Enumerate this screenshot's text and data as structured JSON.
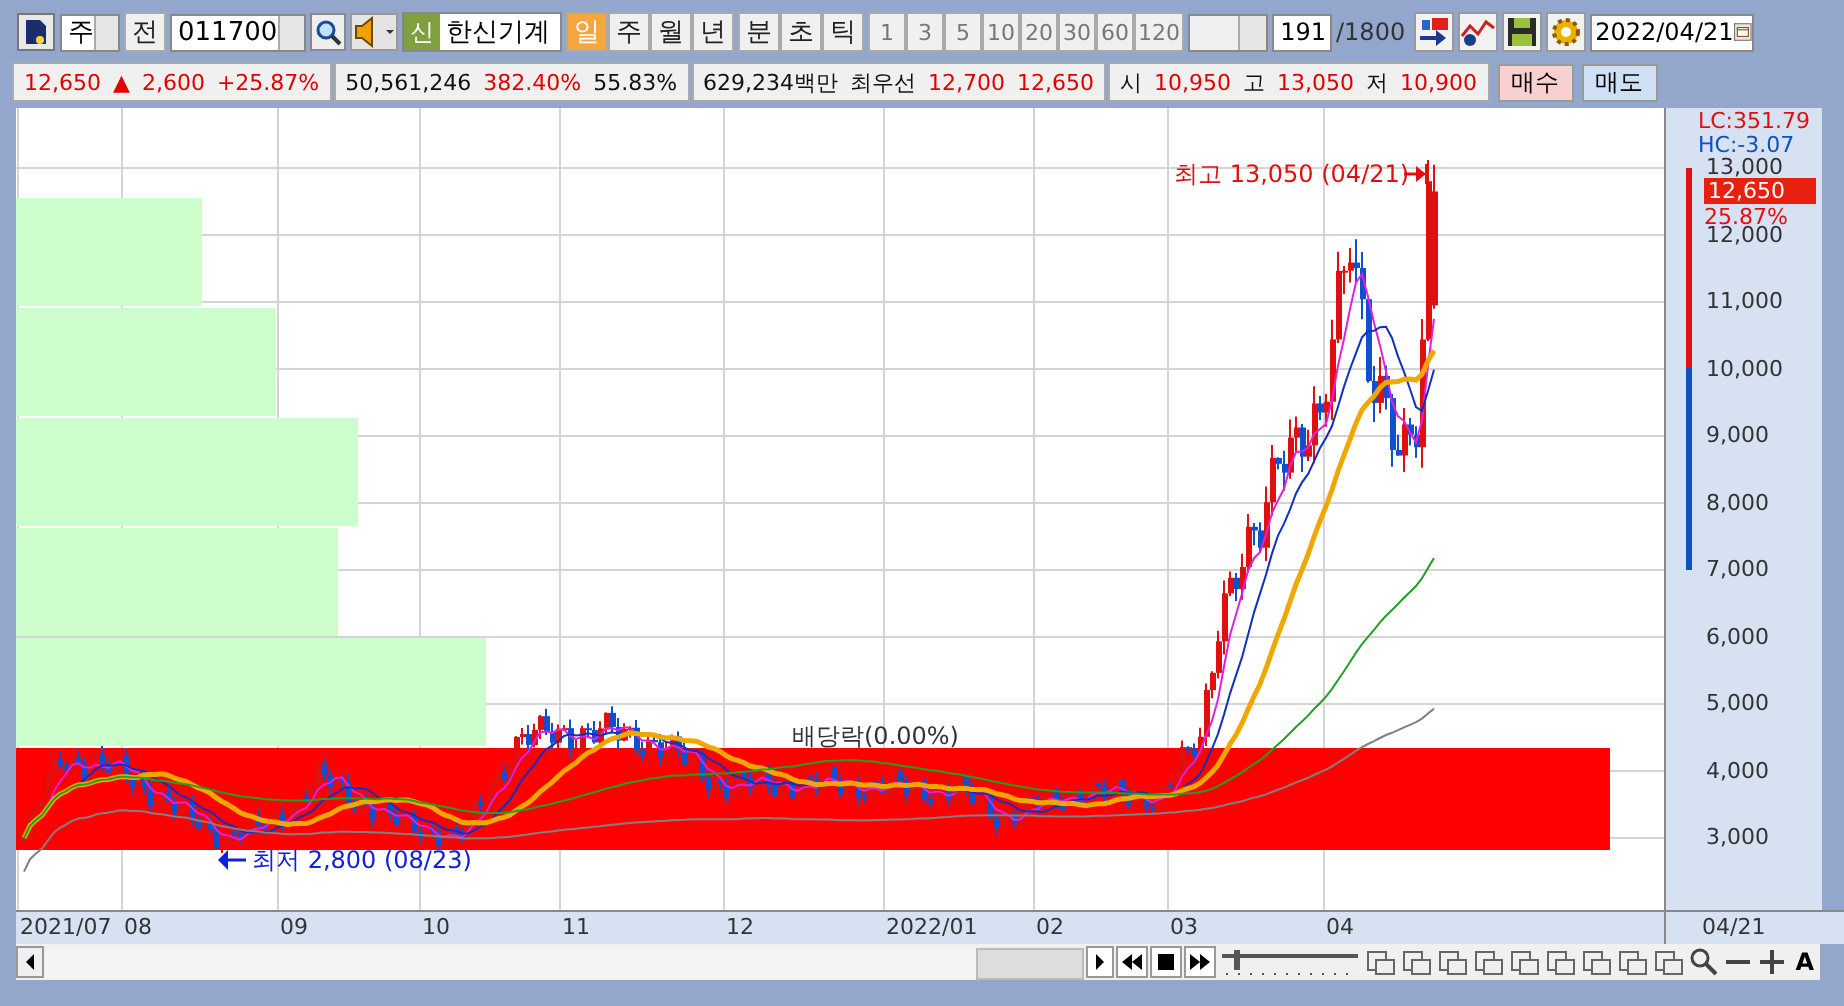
{
  "toolbar": {
    "market": "주",
    "prev_label": "전",
    "code": "011700",
    "name_badge": "신",
    "name": "한신기계",
    "periods": [
      {
        "label": "일",
        "selected": true
      },
      {
        "label": "주",
        "selected": false
      },
      {
        "label": "월",
        "selected": false
      },
      {
        "label": "년",
        "selected": false
      }
    ],
    "intraday": [
      {
        "label": "분",
        "selected": false
      },
      {
        "label": "초",
        "selected": false
      },
      {
        "label": "틱",
        "selected": false
      }
    ],
    "intervals": [
      "1",
      "3",
      "5",
      "10",
      "20",
      "30",
      "60",
      "120"
    ],
    "count": "191",
    "total": "/1800",
    "date": "2022/04/21"
  },
  "quote": {
    "groups": [
      [
        {
          "text": "12,650",
          "color": "#e00000"
        },
        {
          "text": "▲",
          "color": "#e00000"
        },
        {
          "text": "2,600",
          "color": "#e00000"
        },
        {
          "text": "+25.87%",
          "color": "#e00000"
        }
      ],
      [
        {
          "text": "50,561,246",
          "color": "#111111"
        },
        {
          "text": "382.40%",
          "color": "#e00000"
        },
        {
          "text": "55.83%",
          "color": "#111111"
        }
      ],
      [
        {
          "text": "629,234백만",
          "color": "#111111"
        },
        {
          "text": "최우선",
          "color": "#111111"
        },
        {
          "text": "12,700",
          "color": "#e00000"
        },
        {
          "text": "12,650",
          "color": "#e00000"
        }
      ],
      [
        {
          "text": "시",
          "color": "#111111"
        },
        {
          "text": "10,950",
          "color": "#e00000"
        },
        {
          "text": "고",
          "color": "#111111"
        },
        {
          "text": "13,050",
          "color": "#e00000"
        },
        {
          "text": "저",
          "color": "#111111"
        },
        {
          "text": "10,900",
          "color": "#e00000"
        }
      ]
    ],
    "buy": "매수",
    "sell": "매도"
  },
  "chart": {
    "high_note": "최고 13,050 (04/21)",
    "low_note": "최저 2,800 (08/23)",
    "event_note": "배당락(0.00%)",
    "lc": "LC:351.79",
    "hc": "HC:-3.07",
    "current": "12,650",
    "current_rate": "25.87%",
    "yticks": [
      "13,000",
      "12,000",
      "11,000",
      "10,000",
      "9,000",
      "8,000",
      "7,000",
      "6,000",
      "5,000",
      "4,000",
      "3,000"
    ],
    "xlabels": [
      "2021/07",
      "08",
      "09",
      "10",
      "11",
      "12",
      "2022/01",
      "02",
      "03",
      "04"
    ],
    "last_date": "04/21"
  },
  "bottom": {
    "font_button": "A"
  }
}
